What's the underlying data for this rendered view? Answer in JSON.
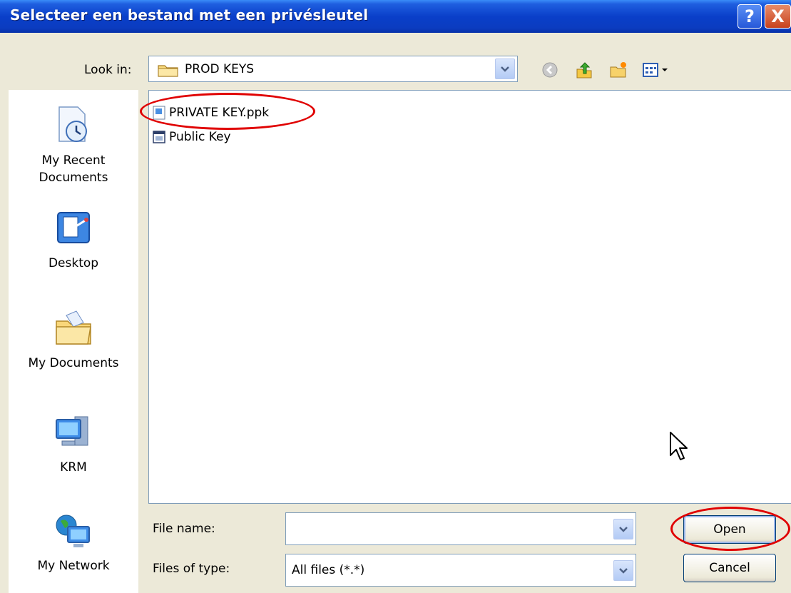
{
  "window": {
    "title": "Selecteer een bestand met een privésleutel",
    "help_label": "?",
    "close_label": "X"
  },
  "lookin": {
    "label": "Look in:",
    "value": "PROD KEYS"
  },
  "toolbar": {
    "back_icon": "back-icon",
    "up_icon": "up-folder-icon",
    "new_folder_icon": "new-folder-icon",
    "views_icon": "views-menu-icon"
  },
  "places": [
    {
      "label": "My Recent\nDocuments",
      "icon": "recent-documents-icon"
    },
    {
      "label": "Desktop",
      "icon": "desktop-icon"
    },
    {
      "label": "My Documents",
      "icon": "my-documents-icon"
    },
    {
      "label": "KRM",
      "icon": "my-computer-icon"
    },
    {
      "label": "My Network",
      "icon": "network-icon"
    }
  ],
  "files": [
    {
      "name": "PRIVATE KEY.ppk",
      "icon": "ppk-file-icon"
    },
    {
      "name": "Public Key",
      "icon": "generic-file-icon"
    }
  ],
  "filename": {
    "label": "File name:",
    "value": ""
  },
  "filetype": {
    "label": "Files of type:",
    "value": "All files (*.*)"
  },
  "buttons": {
    "open": "Open",
    "cancel": "Cancel"
  },
  "colors": {
    "titlebar": "#0A3FC9",
    "dialog_bg": "#ECE9D8",
    "annotation": "#E00000"
  }
}
